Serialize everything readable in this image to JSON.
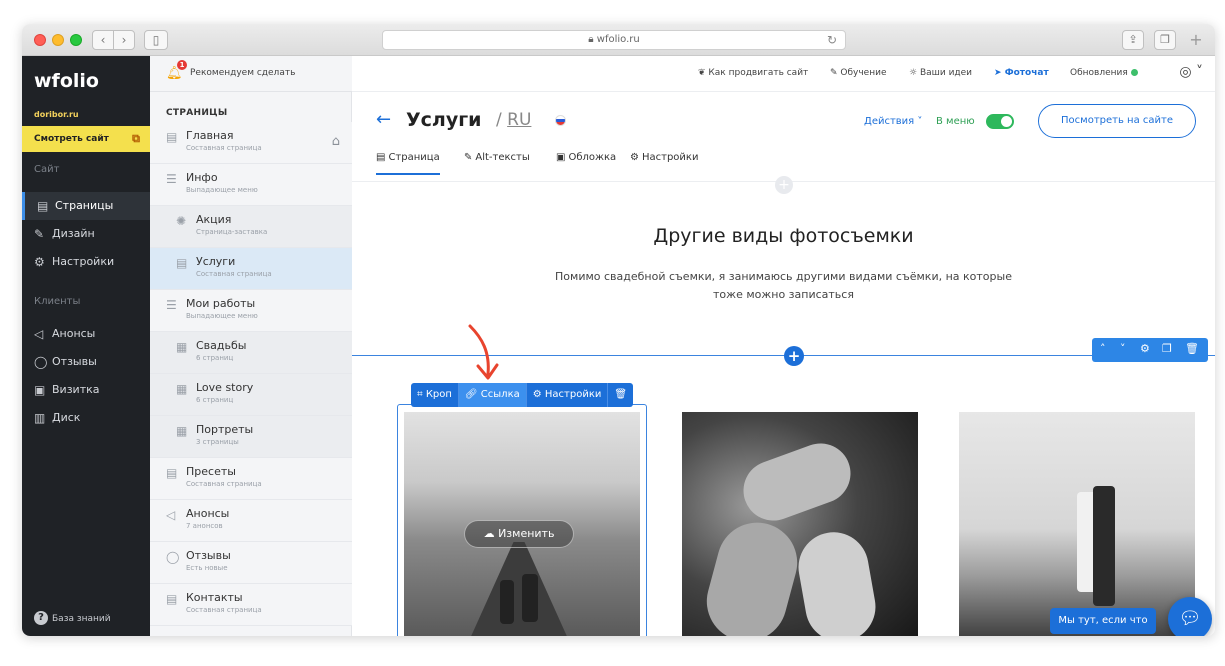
{
  "browser": {
    "url": "wfolio.ru",
    "lock_icon": "lock-icon"
  },
  "sidebar": {
    "logo": "wfolio",
    "domain": "doribor.ru",
    "view_site": "Смотреть сайт",
    "section_site": "Сайт",
    "items_site": [
      {
        "label": "Страницы",
        "icon": "page-icon",
        "active": true
      },
      {
        "label": "Дизайн",
        "icon": "brush-icon"
      },
      {
        "label": "Настройки",
        "icon": "gear-icon"
      }
    ],
    "section_clients": "Клиенты",
    "items_clients": [
      {
        "label": "Анонсы",
        "icon": "megaphone-icon"
      },
      {
        "label": "Отзывы",
        "icon": "chat-icon"
      },
      {
        "label": "Визитка",
        "icon": "card-icon"
      },
      {
        "label": "Диск",
        "icon": "disk-icon"
      }
    ],
    "knowledge_base": "База знаний"
  },
  "notification": {
    "badge": "1",
    "text": "Рекомендуем сделать"
  },
  "pages_panel": {
    "title": "СТРАНИЦЫ",
    "items": [
      {
        "name": "Главная",
        "sub": "Составная страница"
      },
      {
        "name": "Инфо",
        "sub": "Выпадающее меню"
      },
      {
        "name": "Акция",
        "sub": "Страница-заставка"
      },
      {
        "name": "Услуги",
        "sub": "Составная страница"
      },
      {
        "name": "Мои работы",
        "sub": "Выпадающее меню"
      },
      {
        "name": "Свадьбы",
        "sub": "6 страниц"
      },
      {
        "name": "Love story",
        "sub": "6 страниц"
      },
      {
        "name": "Портреты",
        "sub": "3 страницы"
      },
      {
        "name": "Пресеты",
        "sub": "Составная страница"
      },
      {
        "name": "Анонсы",
        "sub": "7 анонсов"
      },
      {
        "name": "Отзывы",
        "sub": "Есть новые"
      },
      {
        "name": "Контакты",
        "sub": "Составная страница"
      }
    ]
  },
  "topbar": {
    "promote": "Как продвигать сайт",
    "learning": "Обучение",
    "ideas": "Ваши идеи",
    "photochat": "Фоточат",
    "updates": "Обновления"
  },
  "header": {
    "title": "Услуги",
    "lang": "RU",
    "actions": "Действия",
    "in_menu": "В меню",
    "view_on_site": "Посмотреть на сайте",
    "tabs": [
      "Страница",
      "Alt-тексты",
      "Обложка",
      "Настройки"
    ]
  },
  "content": {
    "section_title": "Другие виды фотосъемки",
    "section_desc": "Помимо свадебной съемки, я занимаюсь другими видами съёмки, на которые тоже можно записаться",
    "img_toolbar": {
      "crop": "Кроп",
      "link": "Ссылка",
      "settings": "Настройки"
    },
    "change": "Изменить",
    "chat_label": "Мы тут, если что"
  },
  "colors": {
    "accent": "#1c6fd8",
    "sidebar_bg": "#1f2226",
    "highlight_yellow": "#f4e04d",
    "toggle_green": "#2eb85c",
    "annotation_red": "#e8442e"
  }
}
